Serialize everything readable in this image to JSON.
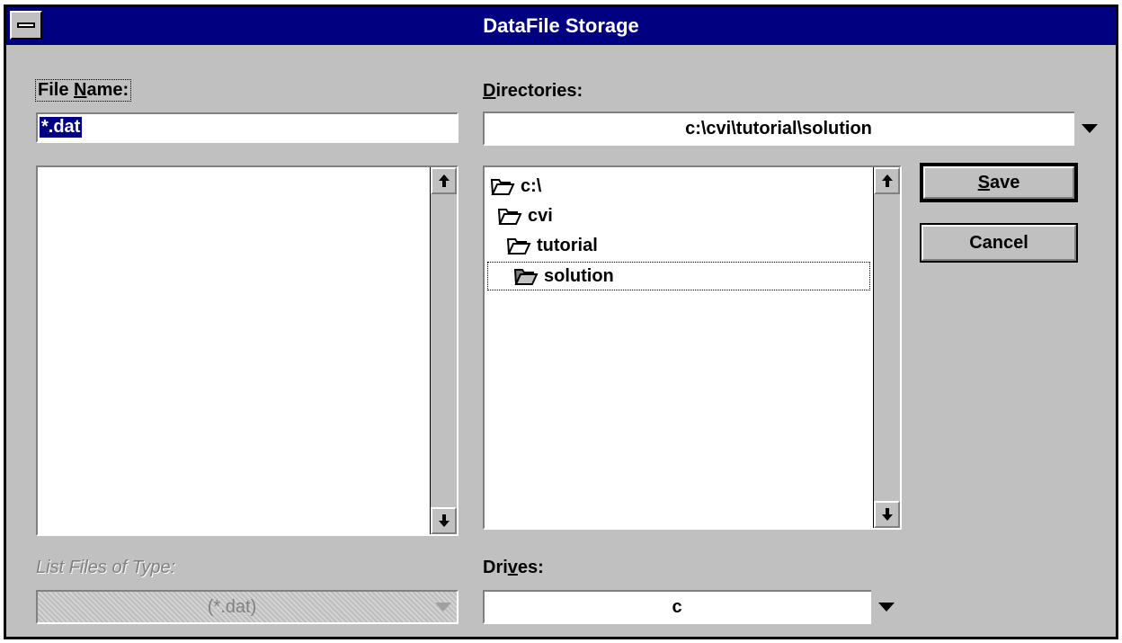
{
  "window": {
    "title": "DataFile Storage"
  },
  "file_name": {
    "label": "File Name:",
    "value": "*.dat"
  },
  "directories": {
    "label": "Directories:",
    "current_path": "c:\\cvi\\tutorial\\solution",
    "items": [
      {
        "label": "c:\\",
        "icon": "folder-open-icon"
      },
      {
        "label": "cvi",
        "icon": "folder-open-icon"
      },
      {
        "label": "tutorial",
        "icon": "folder-open-icon"
      },
      {
        "label": "solution",
        "icon": "folder-open-icon",
        "selected": true
      }
    ]
  },
  "file_list": {
    "items": []
  },
  "list_files_of_type": {
    "label": "List Files of Type:",
    "value": "(*.dat)",
    "enabled": false
  },
  "drives": {
    "label": "Drives:",
    "value": "c"
  },
  "buttons": {
    "save": "Save",
    "cancel": "Cancel"
  },
  "colors": {
    "titlebar": "#000080",
    "face": "#c0c0c0",
    "selection": "#000080"
  }
}
